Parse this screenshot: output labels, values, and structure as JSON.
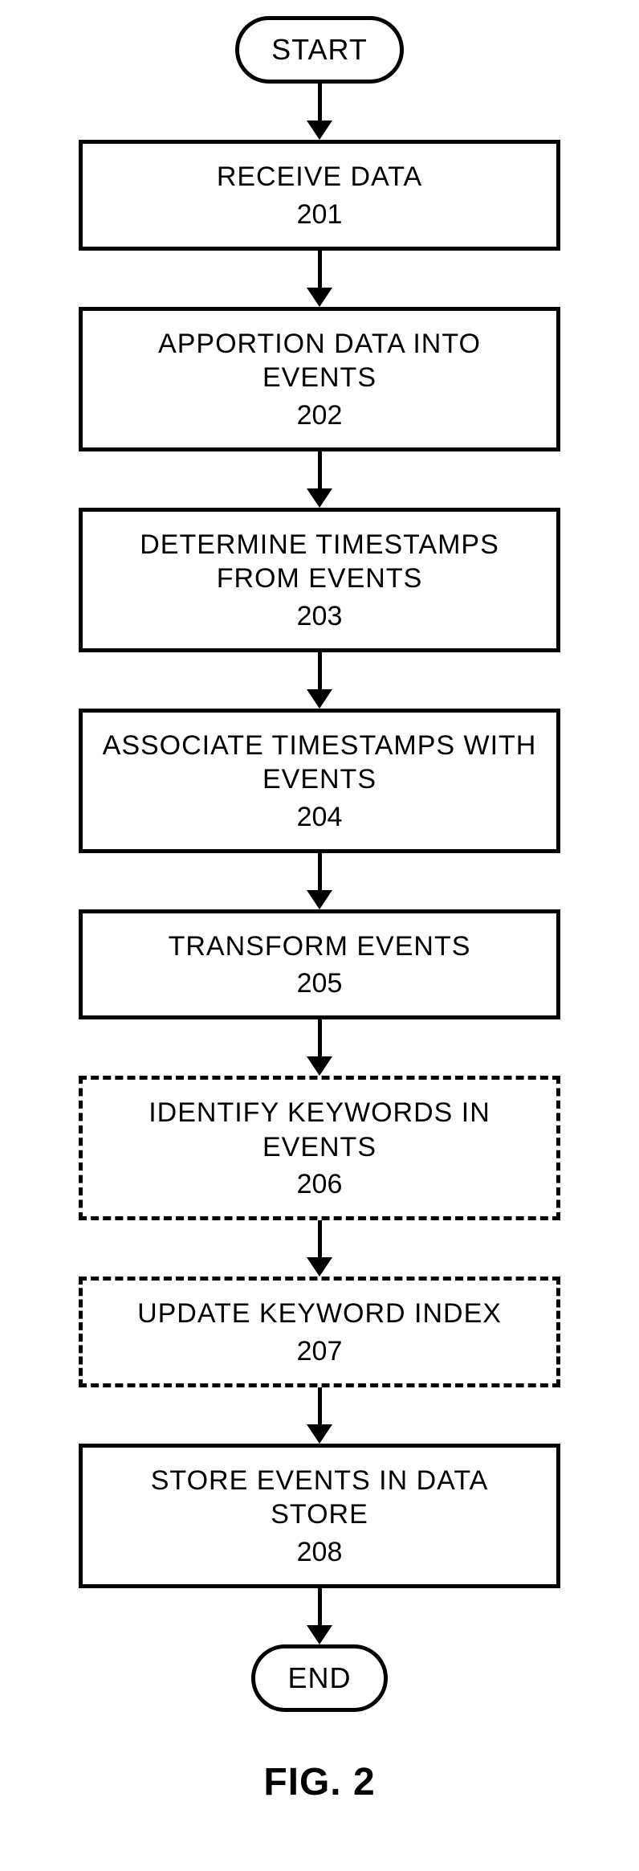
{
  "start": "START",
  "end": "END",
  "steps": [
    {
      "title": "RECEIVE DATA",
      "num": "201",
      "dashed": false
    },
    {
      "title": "APPORTION DATA INTO EVENTS",
      "num": "202",
      "dashed": false
    },
    {
      "title": "DETERMINE TIMESTAMPS FROM EVENTS",
      "num": "203",
      "dashed": false
    },
    {
      "title": "ASSOCIATE TIMESTAMPS WITH EVENTS",
      "num": "204",
      "dashed": false
    },
    {
      "title": "TRANSFORM EVENTS",
      "num": "205",
      "dashed": false
    },
    {
      "title": "IDENTIFY KEYWORDS IN EVENTS",
      "num": "206",
      "dashed": true
    },
    {
      "title": "UPDATE KEYWORD INDEX",
      "num": "207",
      "dashed": true
    },
    {
      "title": "STORE EVENTS IN DATA STORE",
      "num": "208",
      "dashed": false
    }
  ],
  "caption": "FIG. 2"
}
